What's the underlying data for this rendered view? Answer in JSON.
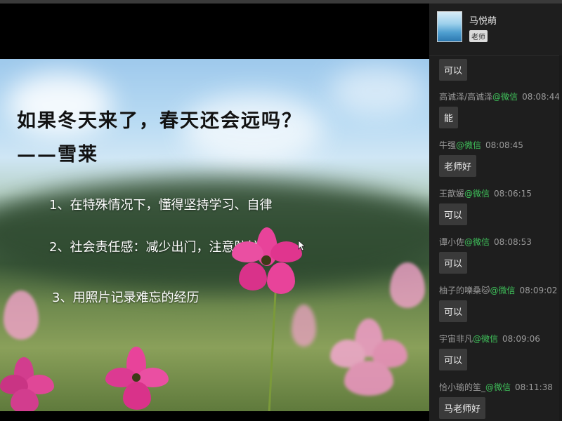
{
  "slide": {
    "title": "如果冬天来了，春天还会远吗？",
    "author": "——雪莱",
    "points": [
      "1、在特殊情况下，懂得坚持学习、自律",
      "2、社会责任感：减少出门，注意防护",
      "3、用照片记录难忘的经历"
    ]
  },
  "chat": {
    "host_name": "马悦萌",
    "host_badge": "老师",
    "messages": [
      {
        "user": "",
        "source": "",
        "time": "",
        "text": "可以"
      },
      {
        "user": "高诚泽/高诚泽",
        "source": "@微信",
        "time": "08:08:44",
        "text": "能"
      },
      {
        "user": "牛强",
        "source": "@微信",
        "time": "08:08:45",
        "text": "老师好"
      },
      {
        "user": "王歆媛",
        "source": "@微信",
        "time": "08:06:15",
        "text": "可以"
      },
      {
        "user": "谭小佐",
        "source": "@微信",
        "time": "08:08:53",
        "text": "可以"
      },
      {
        "user": "柚子的嚛桑🐱",
        "source": "@微信",
        "time": "08:09:02",
        "text": "可以"
      },
      {
        "user": "宇宙非凡",
        "source": "@微信",
        "time": "08:09:06",
        "text": "可以"
      },
      {
        "user": "恰小瑜的笙_",
        "source": "@微信",
        "time": "08:11:38",
        "text": "马老师好"
      }
    ]
  },
  "colors": {
    "chat_bg": "#1e1e1e",
    "bubble_bg": "#3a3a3a",
    "source_green": "#3fc15a",
    "flower_pink": "#e8439a"
  },
  "icons": {
    "cursor": "mouse-pointer-icon",
    "avatar": "user-avatar"
  }
}
